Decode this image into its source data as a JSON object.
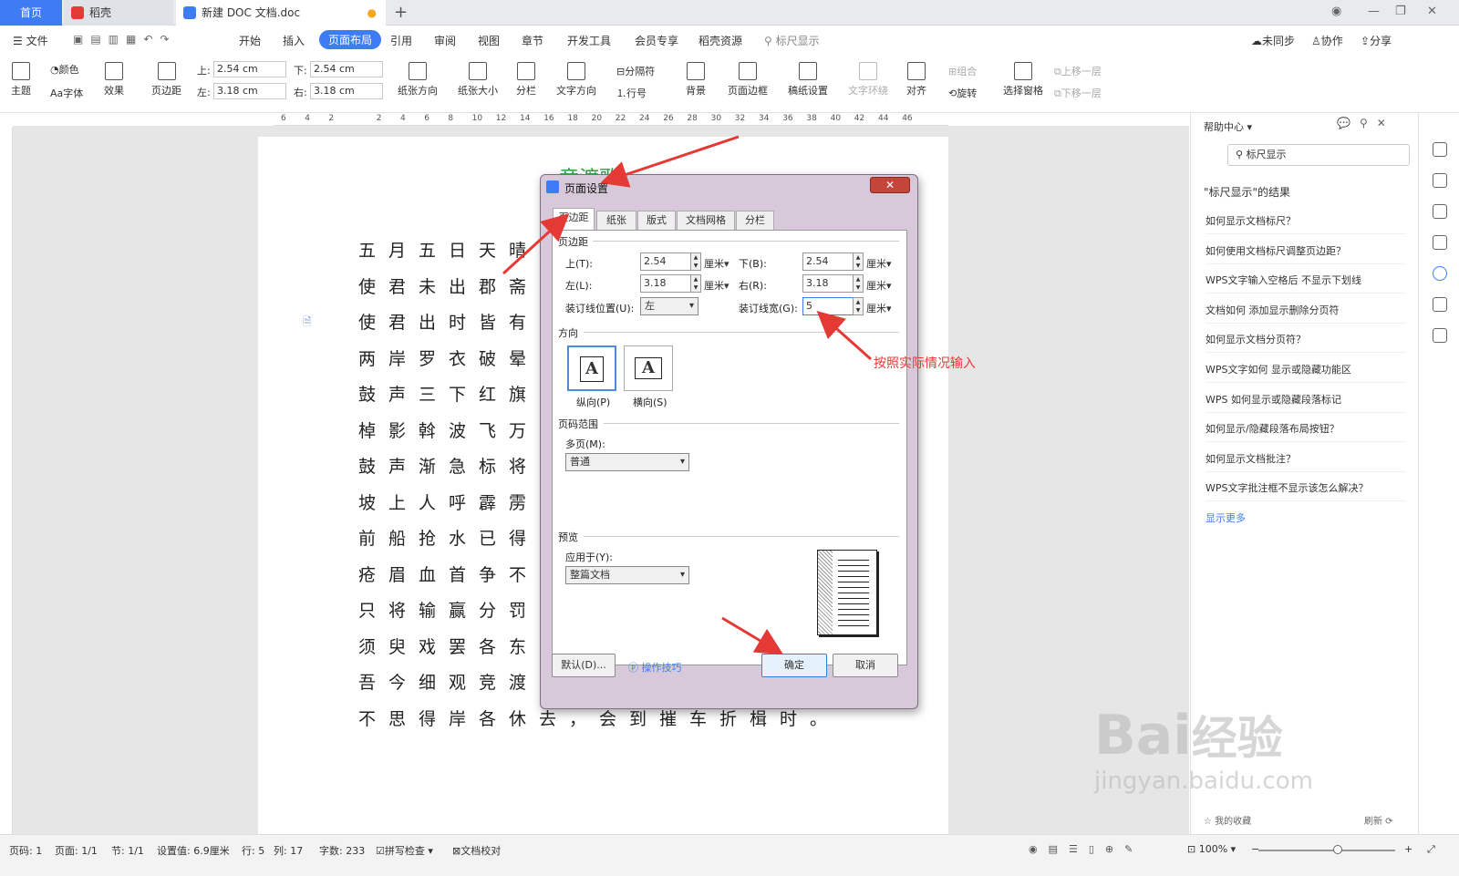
{
  "tabs": {
    "home": "首页",
    "t2": "稻壳",
    "t3": "新建 DOC 文档.doc"
  },
  "menu": {
    "file": "文件",
    "items": [
      "开始",
      "插入",
      "页面布局",
      "引用",
      "审阅",
      "视图",
      "章节",
      "开发工具",
      "会员专享",
      "稻壳资源"
    ],
    "active": "页面布局",
    "search": "标尺显示",
    "sync": "未同步",
    "collab": "协作",
    "share": "分享"
  },
  "ribbon": {
    "theme": "主题",
    "color": "颜色",
    "font": "字体",
    "effect": "效果",
    "margins": "页边距",
    "top_lbl": "上:",
    "top_val": "2.54 cm",
    "bottom_lbl": "下:",
    "bottom_val": "2.54 cm",
    "left_lbl": "左:",
    "left_val": "3.18 cm",
    "right_lbl": "右:",
    "right_val": "3.18 cm",
    "orient": "纸张方向",
    "size": "纸张大小",
    "cols": "分栏",
    "textdir": "文字方向",
    "breaks": "分隔符",
    "lineno": "行号",
    "bg": "背景",
    "border": "页面边框",
    "grid": "稿纸设置",
    "wrap": "文字环绕",
    "align": "对齐",
    "group": "组合",
    "rotate": "旋转",
    "selpane": "选择窗格",
    "fwd": "上移一层",
    "back": "下移一层"
  },
  "ruler_ticks": [
    "6",
    "4",
    "2",
    "",
    "2",
    "4",
    "6",
    "8",
    "10",
    "12",
    "14",
    "16",
    "18",
    "20",
    "22",
    "24",
    "26",
    "28",
    "30",
    "32",
    "34",
    "36",
    "38",
    "40",
    "42",
    "44",
    "46"
  ],
  "doc": {
    "title": "竞渡歌",
    "lines": [
      "五月五日天晴",
      "使君未出郡斋",
      "使君出时皆有",
      "两岸罗衣破晕",
      "鼓声三下红旗",
      "棹影斡波飞万",
      "鼓声渐急标将",
      "坡上人呼霹雳",
      "前船抢水已得",
      "疮眉血首争不",
      "只将输赢分罚",
      "须臾戏罢各东",
      "吾今细观竞渡",
      "不思得岸各休去，会到摧车折楫时。"
    ]
  },
  "dialog": {
    "title": "页面设置",
    "tabs": [
      "页边距",
      "纸张",
      "版式",
      "文档网格",
      "分栏"
    ],
    "sec_margin": "页边距",
    "top_lbl": "上(T):",
    "top": "2.54",
    "bottom_lbl": "下(B):",
    "bottom": "2.54",
    "left_lbl": "左(L):",
    "left": "3.18",
    "right_lbl": "右(R):",
    "right": "3.18",
    "unit": "厘米",
    "gutter_pos_lbl": "装订线位置(U):",
    "gutter_pos": "左",
    "gutter_lbl": "装订线宽(G):",
    "gutter": "5",
    "sec_orient": "方向",
    "portrait": "纵向(P)",
    "landscape": "横向(S)",
    "sec_range": "页码范围",
    "multi_lbl": "多页(M):",
    "multi": "普通",
    "sec_preview": "预览",
    "apply_lbl": "应用于(Y):",
    "apply": "整篇文档",
    "default": "默认(D)...",
    "tips": "操作技巧",
    "ok": "确定",
    "cancel": "取消"
  },
  "annotation": "按照实际情况输入",
  "help": {
    "title": "帮助中心",
    "search": "标尺显示",
    "result": "\"标尺显示\"的结果",
    "items": [
      "如何显示文档标尺？",
      "如何使用文档标尺调整页边距？",
      "WPS文字输入空格后 不显示下划线",
      "文档如何 添加显示删除分页符",
      "如何显示文档分页符？",
      "WPS文字如何 显示或隐藏功能区",
      "WPS 如何显示或隐藏段落标记",
      "如何显示/隐藏段落布局按钮？",
      "如何显示文档批注？",
      "WPS文字批注框不显示该怎么解决？"
    ],
    "more": "显示更多",
    "fav": "我的收藏",
    "refresh": "刷新"
  },
  "status": {
    "pageno": "页码: 1",
    "pages": "页面: 1/1",
    "section": "节: 1/1",
    "setting": "设置值: 6.9厘米",
    "row": "行: 5",
    "col": "列: 17",
    "words": "字数: 233",
    "spell": "拼写检查",
    "proof": "文档校对",
    "zoom": "100%"
  },
  "watermark": "Bai经验 jingyan.baidu.com",
  "colors": {
    "accent": "#3d7cf3",
    "annot": "#e53935"
  }
}
